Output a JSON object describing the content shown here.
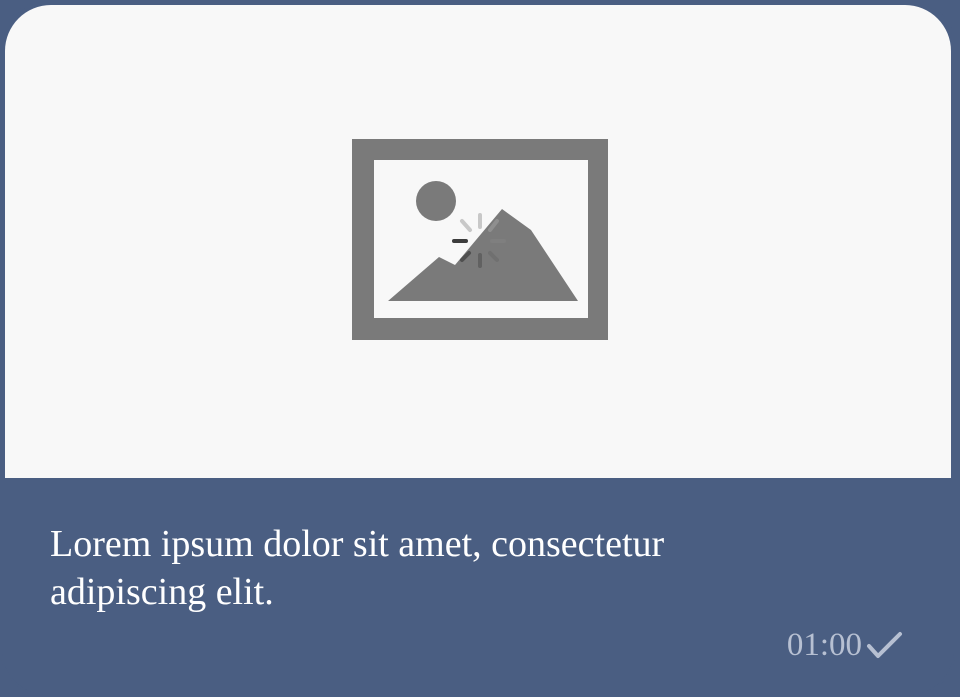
{
  "message": {
    "text": "Lorem ipsum dolor sit amet, consectetur adipiscing elit.",
    "timestamp": "01:00",
    "status_icon": "checkmark-icon"
  },
  "media": {
    "state": "loading",
    "placeholder_icon": "image-placeholder-icon",
    "spinner_icon": "loading-spinner-icon"
  },
  "colors": {
    "bubble": "#4a5e82",
    "image_background": "#f8f8f8",
    "placeholder": "#7a7a7a",
    "text": "#ffffff",
    "timestamp": "#b7c0d2"
  }
}
